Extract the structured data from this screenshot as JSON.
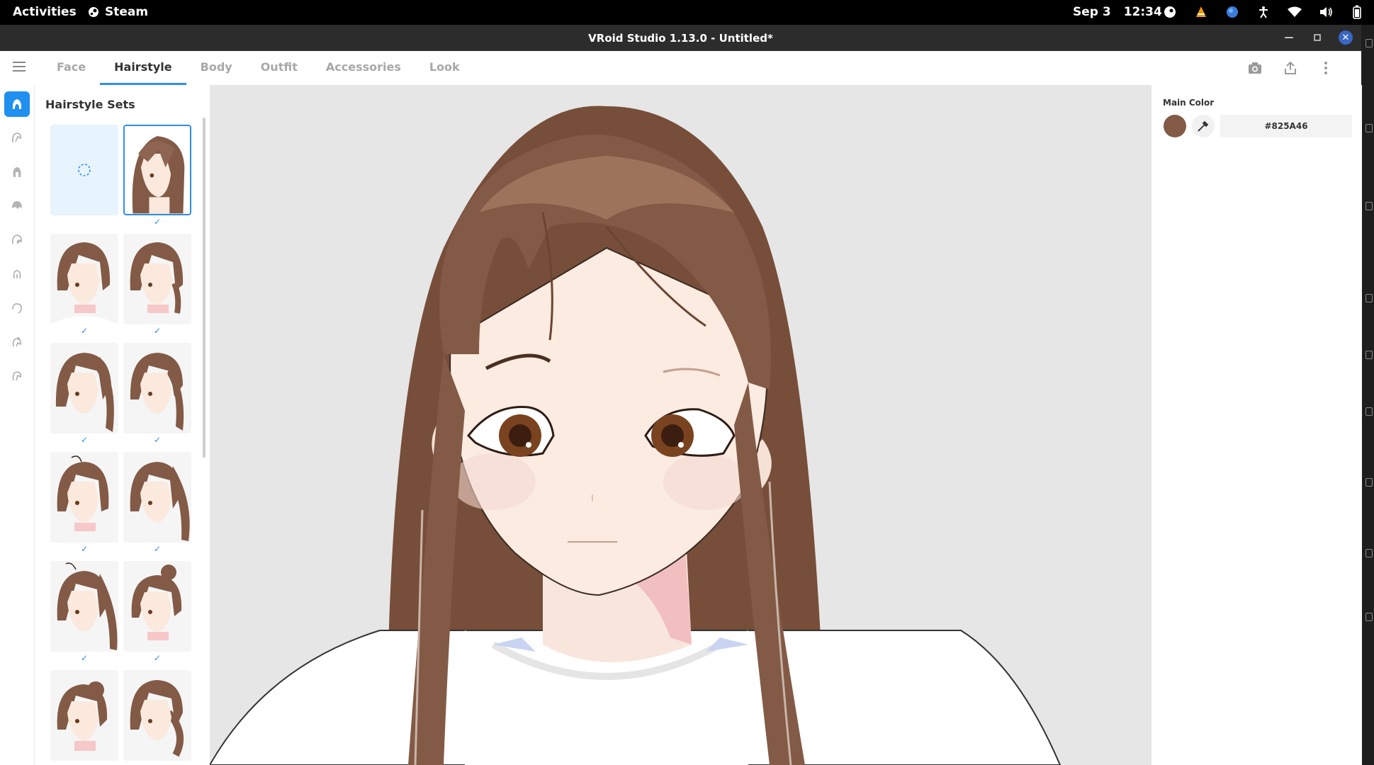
{
  "system_bar": {
    "activities": "Activities",
    "app_name": "Steam",
    "date": "Sep 3",
    "time": "12:34"
  },
  "window": {
    "title": "VRoid Studio 1.13.0 - Untitled*"
  },
  "tabs": [
    {
      "label": "Face"
    },
    {
      "label": "Hairstyle"
    },
    {
      "label": "Body"
    },
    {
      "label": "Outfit"
    },
    {
      "label": "Accessories"
    },
    {
      "label": "Look"
    }
  ],
  "active_tab": "Hairstyle",
  "panel": {
    "title": "Hairstyle Sets"
  },
  "properties": {
    "main_color_label": "Main Color",
    "main_color_hex": "#825A46",
    "swatch_color": "#825A46"
  },
  "colors": {
    "accent": "#2F8DF0",
    "hair": "#825A46",
    "viewport_bg": "#E6E6E6"
  }
}
